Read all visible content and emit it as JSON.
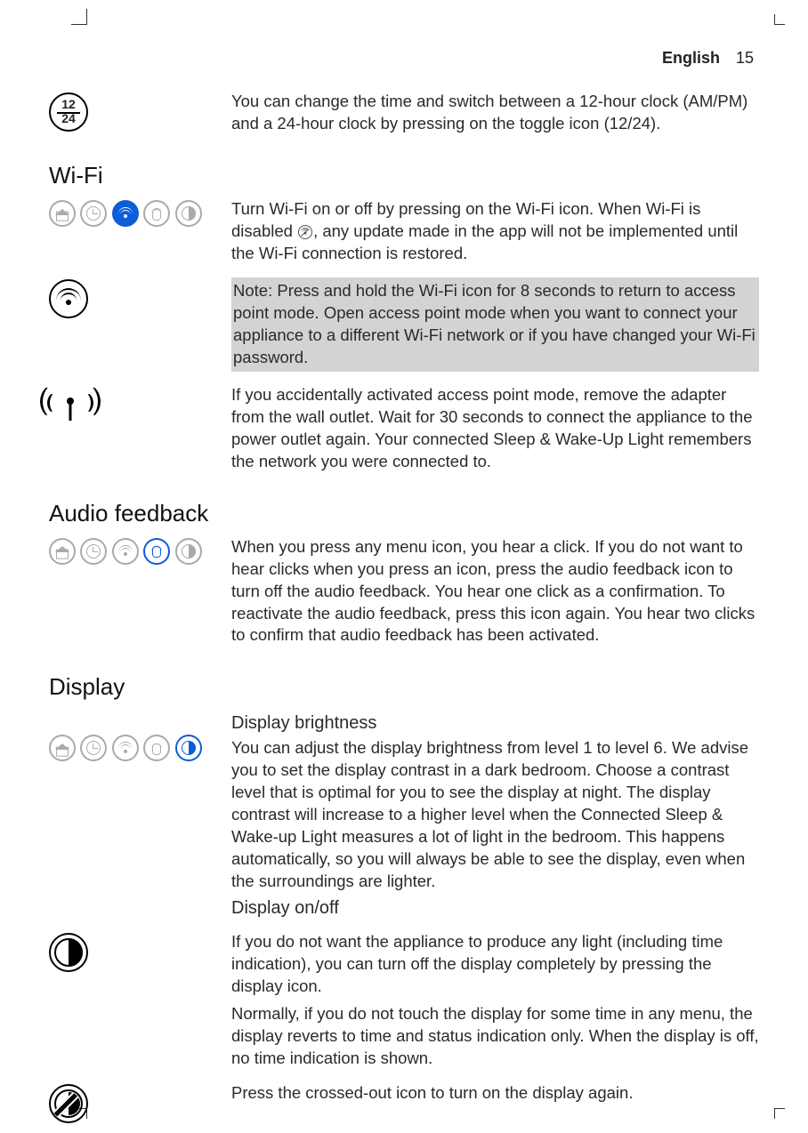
{
  "header": {
    "language": "English",
    "page_number": "15"
  },
  "sections": {
    "clock": {
      "icon_top": "12",
      "icon_bottom": "24",
      "text": "You can change the time and switch between a 12-hour clock (AM/PM) and a 24-hour clock by pressing on the toggle icon (12/24)."
    },
    "wifi": {
      "heading": "Wi-Fi",
      "p1a": "Turn Wi-Fi on or off by pressing on the Wi-Fi icon. When Wi-Fi is disabled ",
      "p1b": ", any update made in the app will not be implemented until the Wi-Fi connection is restored.",
      "note": "Note: Press and hold the Wi-Fi icon for 8 seconds to return to access point mode. Open access point mode when you want to connect your appliance to a different Wi-Fi network or if you have changed your Wi-Fi password.",
      "p2": "If you accidentally activated access point mode, remove the adapter from the wall outlet. Wait for 30 seconds to connect the appliance to the power outlet again. Your connected Sleep & Wake-Up Light remembers the network you were connected to."
    },
    "audio": {
      "heading": "Audio feedback",
      "p1": "When you press any menu icon, you hear a click. If you do not want to hear clicks when you press an icon, press the audio feedback icon to turn off the audio feedback. You hear one click as a confirmation. To reactivate the audio feedback, press this icon again. You hear two clicks to confirm that audio feedback has been activated."
    },
    "display": {
      "heading": "Display",
      "sub1": "Display brightness",
      "p1": "You can adjust the display brightness from level 1 to level 6. We advise you to set the display contrast in a dark bedroom. Choose a contrast level that is optimal for you to see the display at night. The display contrast will increase to a higher level when the Connected Sleep & Wake-up Light measures a lot of light in the bedroom. This happens automatically, so you will always be able to see the display, even when the surroundings are lighter.",
      "sub2": "Display on/off",
      "p2": "If you do not want the appliance to produce any light (including time indication), you can turn off the display completely by pressing the display icon.",
      "p3": "Normally, if you do not touch the display for some time in any menu, the display reverts to time and status indication only. When the display is off, no time indication is shown.",
      "p4": "Press the crossed-out icon to turn on the display again."
    }
  }
}
